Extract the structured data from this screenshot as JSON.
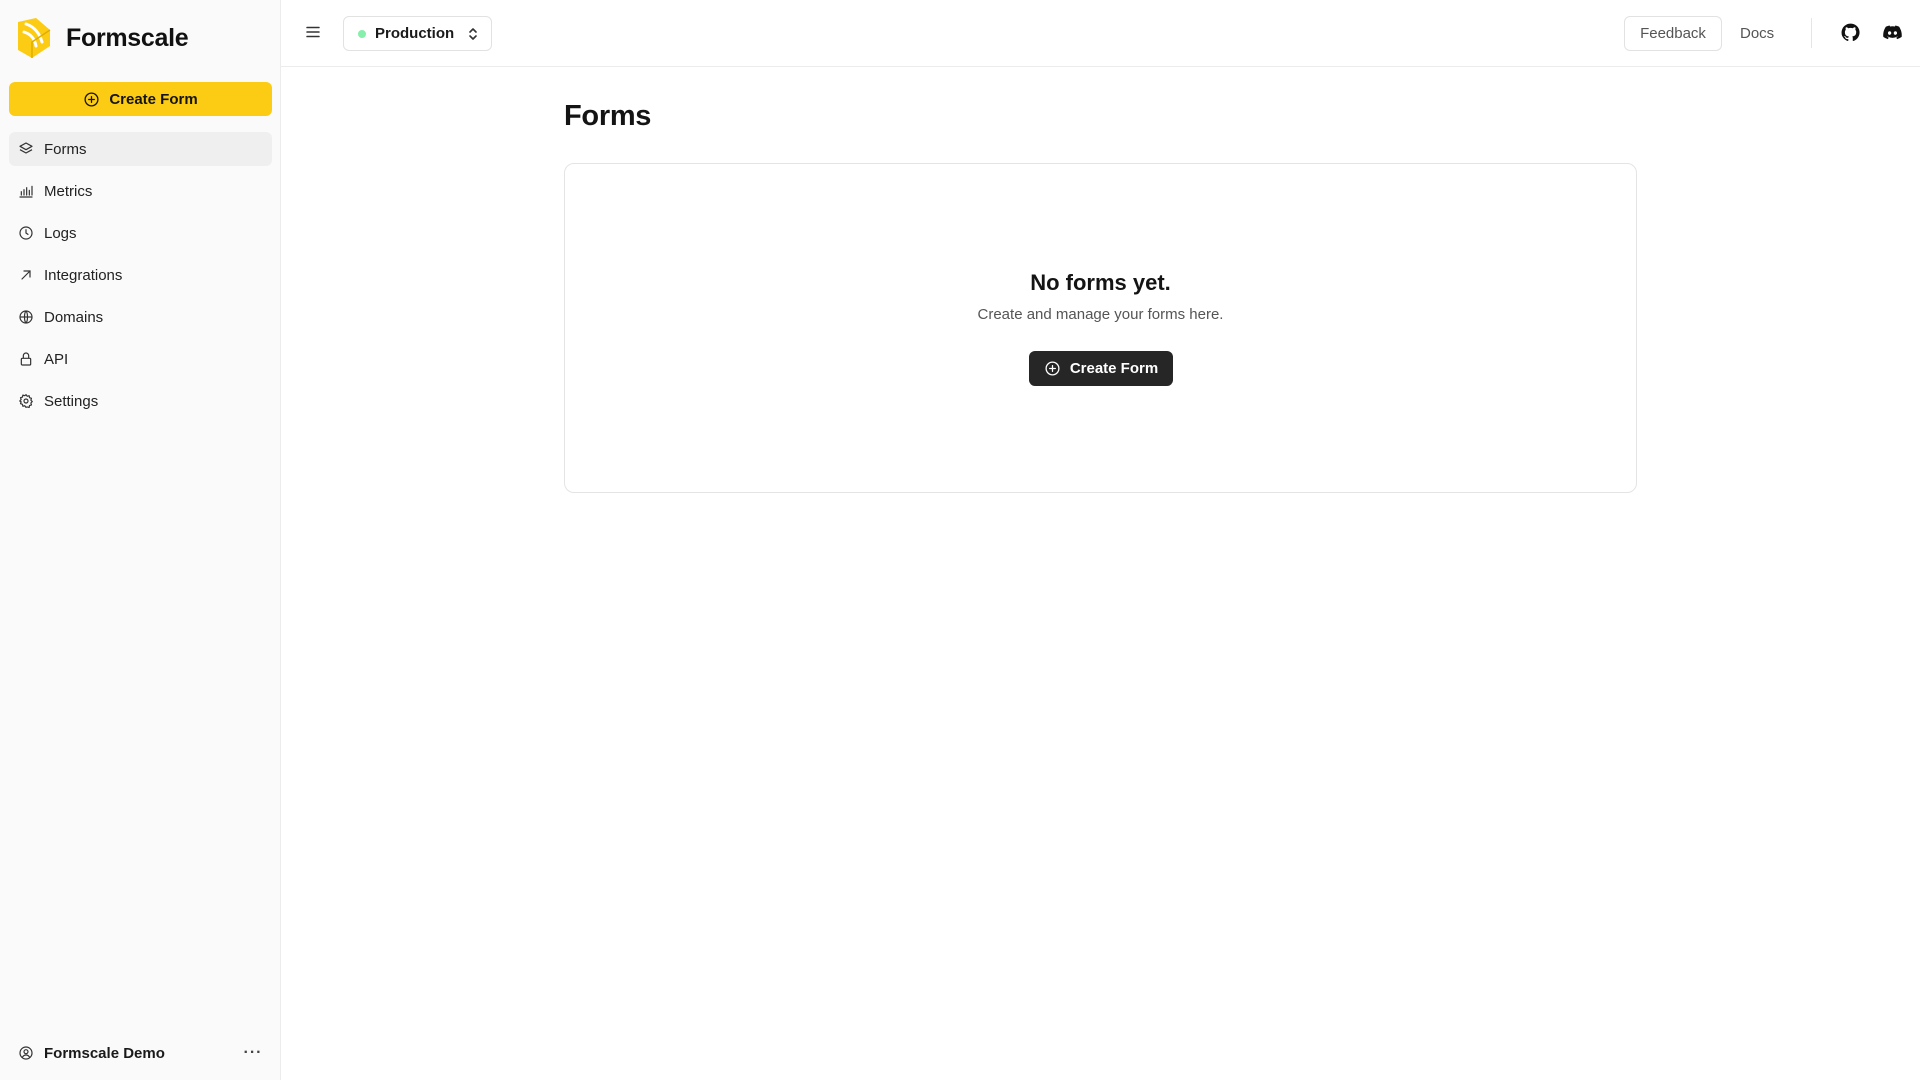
{
  "brand": {
    "name": "Formscale",
    "logo_icon": "formscale-logo-icon",
    "accent": "#fccc14"
  },
  "sidebar": {
    "create_label": "Create Form",
    "items": [
      {
        "label": "Forms",
        "icon": "layers-icon",
        "active": true
      },
      {
        "label": "Metrics",
        "icon": "bar-chart-icon",
        "active": false
      },
      {
        "label": "Logs",
        "icon": "clock-icon",
        "active": false
      },
      {
        "label": "Integrations",
        "icon": "arrow-up-right-icon",
        "active": false
      },
      {
        "label": "Domains",
        "icon": "globe-icon",
        "active": false
      },
      {
        "label": "API",
        "icon": "lock-icon",
        "active": false
      },
      {
        "label": "Settings",
        "icon": "gear-icon",
        "active": false
      }
    ],
    "user": {
      "name": "Formscale Demo",
      "more": "···"
    }
  },
  "topbar": {
    "environment": {
      "label": "Production",
      "status_color": "#86efac"
    },
    "feedback_label": "Feedback",
    "docs_label": "Docs"
  },
  "main": {
    "title": "Forms",
    "empty": {
      "title": "No forms yet.",
      "subtitle": "Create and manage your forms here.",
      "button_label": "Create Form"
    }
  }
}
